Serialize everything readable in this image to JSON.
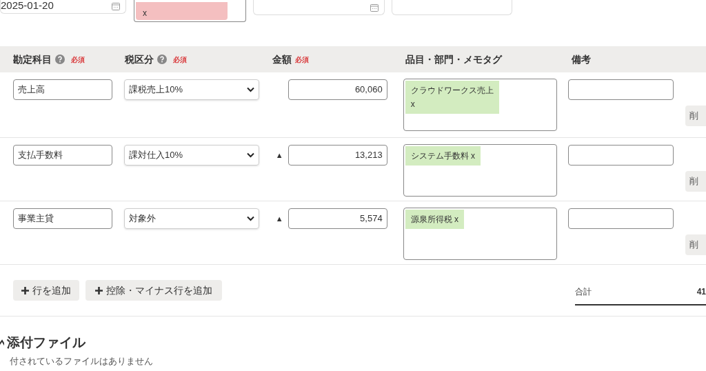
{
  "top_fields": {
    "date": "2025-01-20",
    "partner_tags": [
      {
        "label": "x",
        "color": "#f4bfc0"
      }
    ]
  },
  "header": {
    "account": "勘定科目",
    "account_required": "必須",
    "tax": "税区分",
    "tax_required": "必須",
    "amount": "金額",
    "amount_required": "必須",
    "tags": "品目・部門・メモタグ",
    "memo": "備考"
  },
  "rows": [
    {
      "account": "売上高",
      "tax": "課税売上10%",
      "amount": "60,060",
      "tags": [
        {
          "label": "クラウドワークス売上",
          "remove": "x",
          "color": "#d3ecc0"
        }
      ],
      "delete": "削"
    },
    {
      "account": "支払手数料",
      "tax": "課対仕入10%",
      "minus_mark": "▲",
      "amount": "13,213",
      "tags": [
        {
          "label": "システム手数料",
          "remove": "x",
          "color": "#d3ecc0"
        }
      ],
      "delete": "削"
    },
    {
      "account": "事業主貸",
      "tax": "対象外",
      "minus_mark": "▲",
      "amount": "5,574",
      "tags": [
        {
          "label": "源泉所得税",
          "remove": "x",
          "color": "#d3ecc0"
        }
      ],
      "delete": "削"
    }
  ],
  "actions": {
    "add_row": "行を追加",
    "add_minus_row": "控除・マイナス行を追加",
    "total_label": "合計",
    "total_value": "41"
  },
  "attachments": {
    "title": "添付ファイル",
    "empty_message": "付されているファイルはありません"
  }
}
